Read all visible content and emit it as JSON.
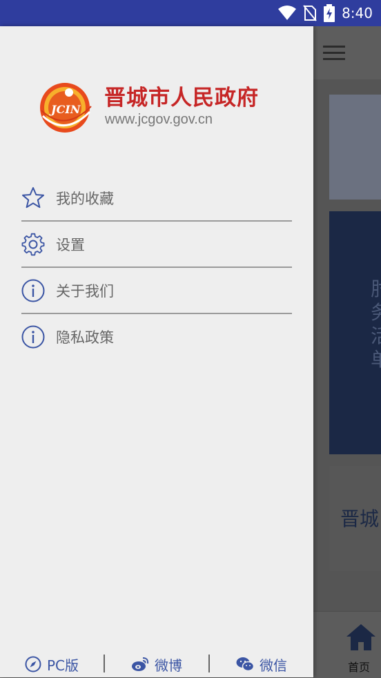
{
  "status_bar": {
    "time": "8:40",
    "icons": [
      "wifi-icon",
      "no-sim-icon",
      "battery-charging-icon"
    ],
    "background": "#2f3d9e"
  },
  "drawer": {
    "logo": {
      "emblem_text": "JCIN",
      "title": "晋城市人民政府",
      "url": "www.jcgov.gov.cn",
      "title_color": "#c62626"
    },
    "menu": [
      {
        "label": "我的收藏",
        "icon": "star-icon"
      },
      {
        "label": "设置",
        "icon": "gear-icon"
      },
      {
        "label": "关于我们",
        "icon": "info-icon"
      },
      {
        "label": "隐私政策",
        "icon": "info-icon"
      }
    ],
    "footer": [
      {
        "label": "PC版",
        "icon": "compass-icon"
      },
      {
        "label": "微博",
        "icon": "weibo-icon"
      },
      {
        "label": "微信",
        "icon": "wechat-icon"
      }
    ],
    "accent_color": "#3b55a4"
  },
  "background_app": {
    "banner_text": "肘 务 活 单",
    "card_title": "晋城",
    "bottom_nav": {
      "label": "首页",
      "icon": "home-icon"
    }
  }
}
